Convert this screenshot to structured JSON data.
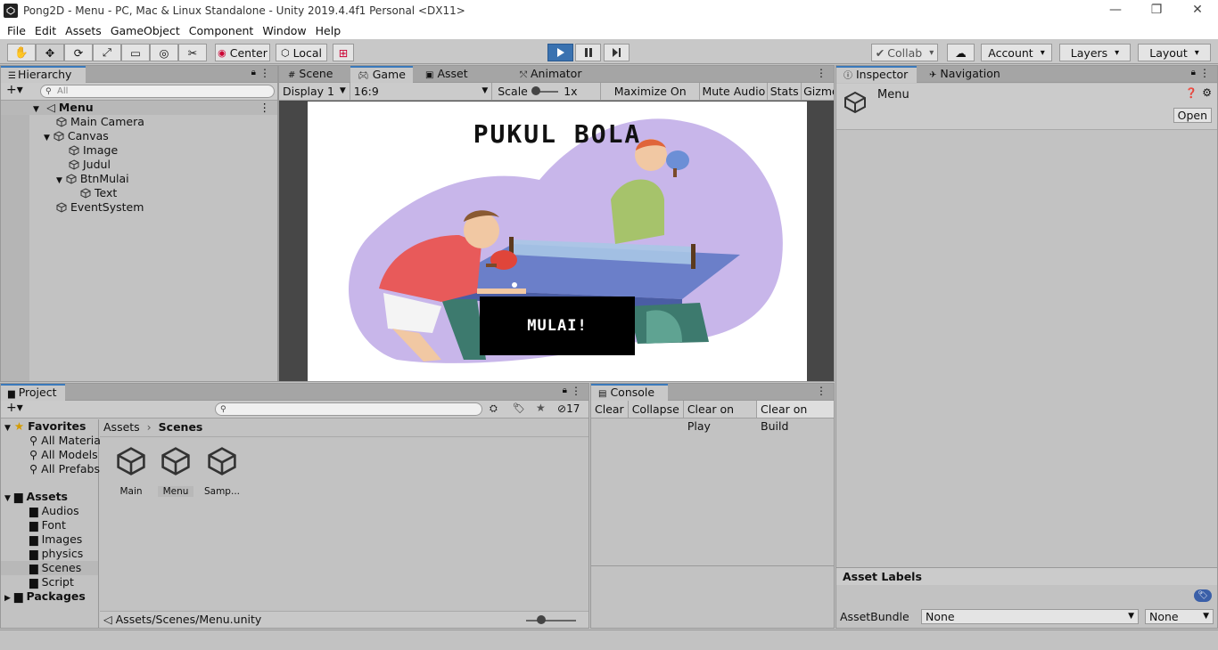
{
  "window": {
    "title": "Pong2D - Menu - PC, Mac & Linux Standalone - Unity 2019.4.4f1 Personal <DX11>"
  },
  "menu": [
    "File",
    "Edit",
    "Assets",
    "GameObject",
    "Component",
    "Window",
    "Help"
  ],
  "toolbar": {
    "pivot_label": "Center",
    "space_label": "Local",
    "collab_label": "Collab",
    "account_label": "Account",
    "layers_label": "Layers",
    "layout_label": "Layout"
  },
  "hierarchy": {
    "tab_label": "Hierarchy",
    "search_placeholder": "All",
    "scene": "Menu",
    "items": [
      "Main Camera",
      "Canvas",
      "Image",
      "Judul",
      "BtnMulai",
      "Text",
      "EventSystem"
    ]
  },
  "game": {
    "tabs": [
      "Scene",
      "Game",
      "Asset Store",
      "Animator"
    ],
    "display": "Display 1",
    "aspect": "16:9",
    "scale_label": "Scale",
    "scale_value": "1x",
    "maximize": "Maximize On Play",
    "mute": "Mute Audio",
    "stats": "Stats",
    "gizmos": "Gizmo",
    "title_text": "PUKUL BOLA",
    "button_text": "MULAI!"
  },
  "inspector": {
    "tabs": [
      "Inspector",
      "Navigation"
    ],
    "object_name": "Menu",
    "open_label": "Open",
    "asset_labels": "Asset Labels",
    "assetbundle_label": "AssetBundle",
    "assetbundle_value": "None",
    "variant_value": "None"
  },
  "project": {
    "tab_label": "Project",
    "hidden_count": "17",
    "favorites_label": "Favorites",
    "favorites": [
      "All Materia",
      "All Models",
      "All Prefabs"
    ],
    "assets_label": "Assets",
    "folders": [
      "Audios",
      "Font",
      "Images",
      "physics",
      "Scenes",
      "Script"
    ],
    "packages_label": "Packages",
    "breadcrumb_root": "Assets",
    "breadcrumb_current": "Scenes",
    "files": [
      "Main",
      "Menu",
      "Samp..."
    ],
    "path": "Assets/Scenes/Menu.unity"
  },
  "console": {
    "tab_label": "Console",
    "buttons": [
      "Clear",
      "Collapse",
      "Clear on Play",
      "Clear on Build"
    ]
  },
  "colors": {
    "accent": "#3a72b0",
    "selection": "#3a79bb",
    "game_bg": "#474747"
  }
}
